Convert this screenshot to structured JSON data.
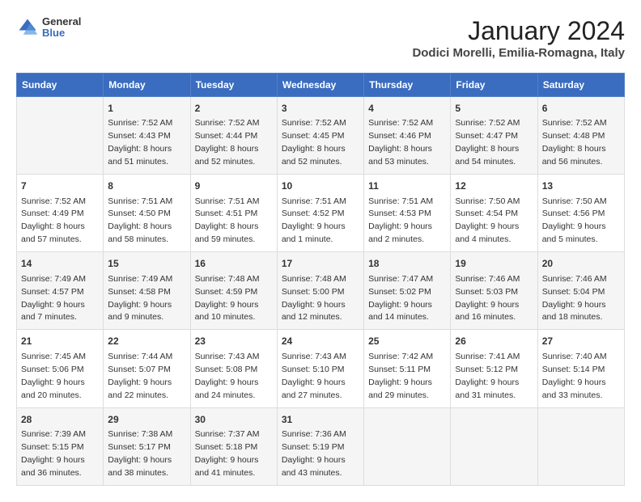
{
  "header": {
    "logo_line1": "General",
    "logo_line2": "Blue",
    "main_title": "January 2024",
    "sub_title": "Dodici Morelli, Emilia-Romagna, Italy"
  },
  "days_of_week": [
    "Sunday",
    "Monday",
    "Tuesday",
    "Wednesday",
    "Thursday",
    "Friday",
    "Saturday"
  ],
  "weeks": [
    [
      {
        "day": "",
        "info": ""
      },
      {
        "day": "1",
        "info": "Sunrise: 7:52 AM\nSunset: 4:43 PM\nDaylight: 8 hours\nand 51 minutes."
      },
      {
        "day": "2",
        "info": "Sunrise: 7:52 AM\nSunset: 4:44 PM\nDaylight: 8 hours\nand 52 minutes."
      },
      {
        "day": "3",
        "info": "Sunrise: 7:52 AM\nSunset: 4:45 PM\nDaylight: 8 hours\nand 52 minutes."
      },
      {
        "day": "4",
        "info": "Sunrise: 7:52 AM\nSunset: 4:46 PM\nDaylight: 8 hours\nand 53 minutes."
      },
      {
        "day": "5",
        "info": "Sunrise: 7:52 AM\nSunset: 4:47 PM\nDaylight: 8 hours\nand 54 minutes."
      },
      {
        "day": "6",
        "info": "Sunrise: 7:52 AM\nSunset: 4:48 PM\nDaylight: 8 hours\nand 56 minutes."
      }
    ],
    [
      {
        "day": "7",
        "info": "Sunrise: 7:52 AM\nSunset: 4:49 PM\nDaylight: 8 hours\nand 57 minutes."
      },
      {
        "day": "8",
        "info": "Sunrise: 7:51 AM\nSunset: 4:50 PM\nDaylight: 8 hours\nand 58 minutes."
      },
      {
        "day": "9",
        "info": "Sunrise: 7:51 AM\nSunset: 4:51 PM\nDaylight: 8 hours\nand 59 minutes."
      },
      {
        "day": "10",
        "info": "Sunrise: 7:51 AM\nSunset: 4:52 PM\nDaylight: 9 hours\nand 1 minute."
      },
      {
        "day": "11",
        "info": "Sunrise: 7:51 AM\nSunset: 4:53 PM\nDaylight: 9 hours\nand 2 minutes."
      },
      {
        "day": "12",
        "info": "Sunrise: 7:50 AM\nSunset: 4:54 PM\nDaylight: 9 hours\nand 4 minutes."
      },
      {
        "day": "13",
        "info": "Sunrise: 7:50 AM\nSunset: 4:56 PM\nDaylight: 9 hours\nand 5 minutes."
      }
    ],
    [
      {
        "day": "14",
        "info": "Sunrise: 7:49 AM\nSunset: 4:57 PM\nDaylight: 9 hours\nand 7 minutes."
      },
      {
        "day": "15",
        "info": "Sunrise: 7:49 AM\nSunset: 4:58 PM\nDaylight: 9 hours\nand 9 minutes."
      },
      {
        "day": "16",
        "info": "Sunrise: 7:48 AM\nSunset: 4:59 PM\nDaylight: 9 hours\nand 10 minutes."
      },
      {
        "day": "17",
        "info": "Sunrise: 7:48 AM\nSunset: 5:00 PM\nDaylight: 9 hours\nand 12 minutes."
      },
      {
        "day": "18",
        "info": "Sunrise: 7:47 AM\nSunset: 5:02 PM\nDaylight: 9 hours\nand 14 minutes."
      },
      {
        "day": "19",
        "info": "Sunrise: 7:46 AM\nSunset: 5:03 PM\nDaylight: 9 hours\nand 16 minutes."
      },
      {
        "day": "20",
        "info": "Sunrise: 7:46 AM\nSunset: 5:04 PM\nDaylight: 9 hours\nand 18 minutes."
      }
    ],
    [
      {
        "day": "21",
        "info": "Sunrise: 7:45 AM\nSunset: 5:06 PM\nDaylight: 9 hours\nand 20 minutes."
      },
      {
        "day": "22",
        "info": "Sunrise: 7:44 AM\nSunset: 5:07 PM\nDaylight: 9 hours\nand 22 minutes."
      },
      {
        "day": "23",
        "info": "Sunrise: 7:43 AM\nSunset: 5:08 PM\nDaylight: 9 hours\nand 24 minutes."
      },
      {
        "day": "24",
        "info": "Sunrise: 7:43 AM\nSunset: 5:10 PM\nDaylight: 9 hours\nand 27 minutes."
      },
      {
        "day": "25",
        "info": "Sunrise: 7:42 AM\nSunset: 5:11 PM\nDaylight: 9 hours\nand 29 minutes."
      },
      {
        "day": "26",
        "info": "Sunrise: 7:41 AM\nSunset: 5:12 PM\nDaylight: 9 hours\nand 31 minutes."
      },
      {
        "day": "27",
        "info": "Sunrise: 7:40 AM\nSunset: 5:14 PM\nDaylight: 9 hours\nand 33 minutes."
      }
    ],
    [
      {
        "day": "28",
        "info": "Sunrise: 7:39 AM\nSunset: 5:15 PM\nDaylight: 9 hours\nand 36 minutes."
      },
      {
        "day": "29",
        "info": "Sunrise: 7:38 AM\nSunset: 5:17 PM\nDaylight: 9 hours\nand 38 minutes."
      },
      {
        "day": "30",
        "info": "Sunrise: 7:37 AM\nSunset: 5:18 PM\nDaylight: 9 hours\nand 41 minutes."
      },
      {
        "day": "31",
        "info": "Sunrise: 7:36 AM\nSunset: 5:19 PM\nDaylight: 9 hours\nand 43 minutes."
      },
      {
        "day": "",
        "info": ""
      },
      {
        "day": "",
        "info": ""
      },
      {
        "day": "",
        "info": ""
      }
    ]
  ]
}
